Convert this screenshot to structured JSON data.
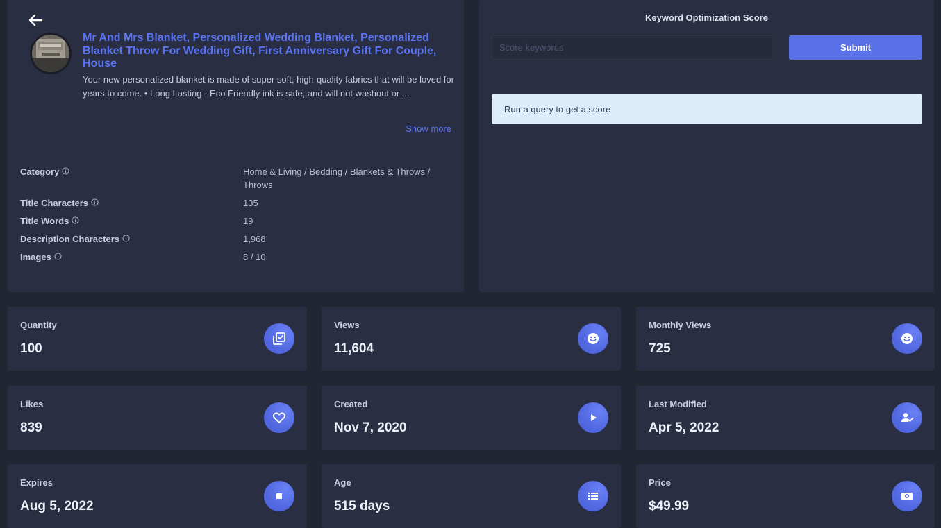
{
  "product": {
    "title": "Mr And Mrs Blanket, Personalized Wedding Blanket, Personalized Blanket Throw For Wedding Gift, First Anniversary Gift For Couple, House",
    "description": "Your new personalized blanket is made of super soft, high-quality fabrics that will be loved for years to come. • Long Lasting - Eco Friendly ink is safe, and will not washout or ...",
    "show_more_label": "Show more",
    "stats": [
      {
        "label": "Category",
        "value": "Home & Living / Bedding / Blankets & Throws / Throws"
      },
      {
        "label": "Title Characters",
        "value": "135"
      },
      {
        "label": "Title Words",
        "value": "19"
      },
      {
        "label": "Description Characters",
        "value": "1,968"
      },
      {
        "label": "Images",
        "value": "8 / 10"
      }
    ]
  },
  "keyword": {
    "title": "Keyword Optimization Score",
    "input_placeholder": "Score keywords",
    "submit_label": "Submit",
    "result_message": "Run a query to get a score"
  },
  "metrics": [
    {
      "label": "Quantity",
      "value": "100",
      "icon": "checklist-icon"
    },
    {
      "label": "Views",
      "value": "11,604",
      "icon": "smile-icon"
    },
    {
      "label": "Monthly Views",
      "value": "725",
      "icon": "smile-icon"
    },
    {
      "label": "Likes",
      "value": "839",
      "icon": "heart-icon"
    },
    {
      "label": "Created",
      "value": "Nov 7, 2020",
      "icon": "play-icon"
    },
    {
      "label": "Last Modified",
      "value": "Apr 5, 2022",
      "icon": "user-check-icon"
    },
    {
      "label": "Expires",
      "value": "Aug 5, 2022",
      "icon": "stop-icon"
    },
    {
      "label": "Age",
      "value": "515 days",
      "icon": "list-icon"
    },
    {
      "label": "Price",
      "value": "$49.99",
      "icon": "money-icon"
    }
  ],
  "colors": {
    "background": "#222532",
    "card": "#2a2e42",
    "accent": "#5a70e6",
    "link": "#5b74f2",
    "alert_bg": "#dcecfb"
  }
}
